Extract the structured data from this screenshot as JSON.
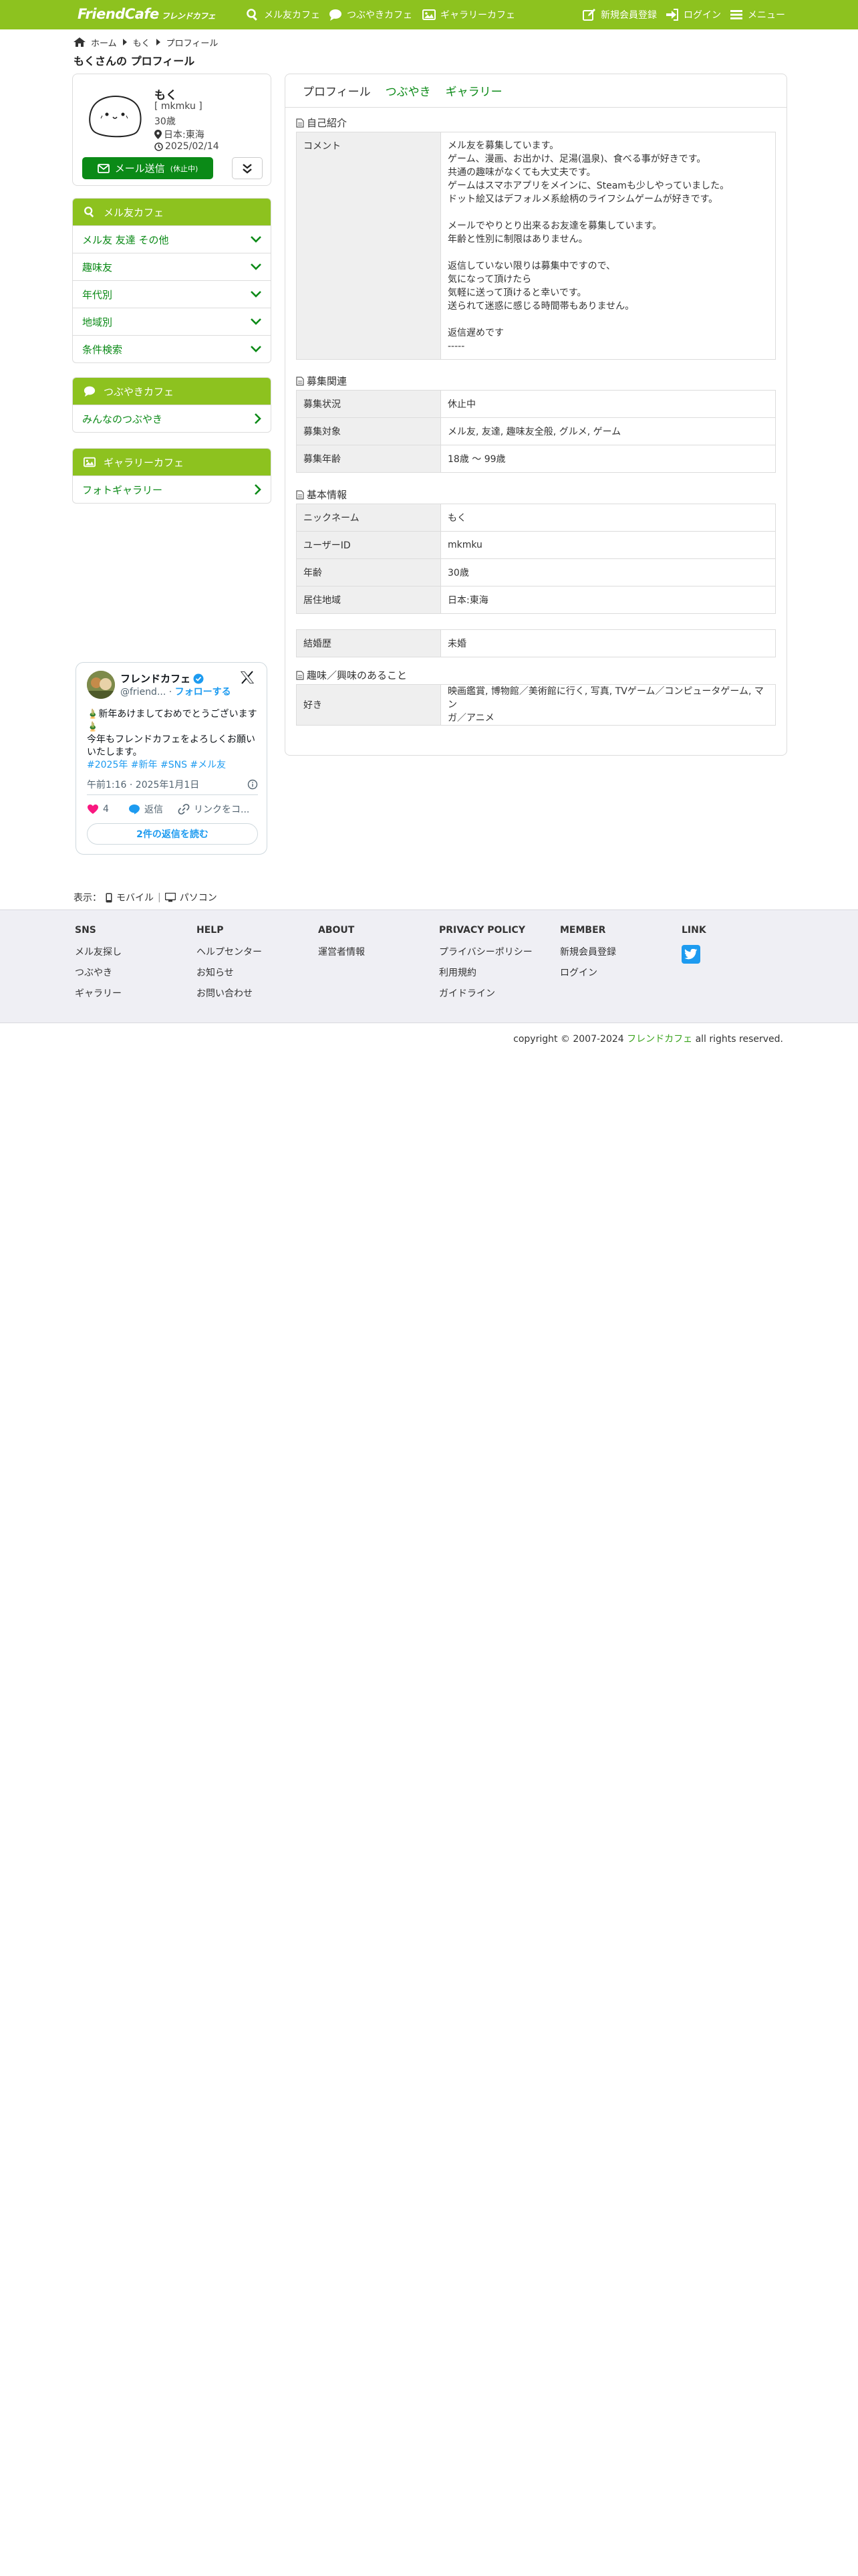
{
  "header": {
    "logo": "FriendCafe",
    "logo_sub": "フレンドカフェ",
    "nav": {
      "mail_cafe": "メル友カフェ",
      "tsubuyaki_cafe": "つぶやきカフェ",
      "gallery_cafe": "ギャラリーカフェ",
      "register": "新規会員登録",
      "login": "ログイン",
      "menu": "メニュー"
    },
    "color": "#8dc21f"
  },
  "breadcrumb": [
    "ホーム",
    "もく",
    "プロフィール"
  ],
  "page_title": "もくさんの プロフィール",
  "profile": {
    "name": "もく",
    "user_id_display": "[ mkmku ]",
    "age": "30歳",
    "location": "日本:東海",
    "date": "2025/02/14",
    "mail_button": "メール送信",
    "mail_button_note": "(休止中)"
  },
  "sidebar": {
    "mail_cafe": {
      "title": "メル友カフェ",
      "items": [
        "メル友 友達 その他",
        "趣味友",
        "年代別",
        "地域別",
        "条件検索"
      ]
    },
    "tsubuyaki_cafe": {
      "title": "つぶやきカフェ",
      "items": [
        "みんなのつぶやき"
      ]
    },
    "gallery_cafe": {
      "title": "ギャラリーカフェ",
      "items": [
        "フォトギャラリー"
      ]
    }
  },
  "tweet": {
    "name": "フレンドカフェ",
    "handle": "@friend...",
    "separator": "·",
    "follow": "フォローする",
    "line1": "🎍新年あけましておめでとうございます🎍",
    "line2": "今年もフレンドカフェをよろしくお願いいたします。",
    "tags": "#2025年 #新年 #SNS #メル友",
    "time": "午前1:16 · 2025年1月1日",
    "likes": "4",
    "reply": "返信",
    "copy_link": "リンクをコ...",
    "read_replies": "2件の返信を読む"
  },
  "tabs": [
    "プロフィール",
    "つぶやき",
    "ギャラリー"
  ],
  "sections": {
    "intro_title": "自己紹介",
    "intro_label": "コメント",
    "intro_lines": [
      "メル友を募集しています。",
      "ゲーム、漫画、お出かけ、足湯(温泉)、食べる事が好きです。",
      "共通の趣味がなくても大丈夫です。",
      "ゲームはスマホアプリをメインに、Steamも少しやっていました。",
      "ドット絵又はデフォルメ系絵柄のライフシムゲームが好きです。",
      "",
      "メールでやりとり出来るお友達を募集しています。",
      "年齢と性別に制限はありません。",
      "",
      "返信していない限りは募集中ですので、",
      "気になって頂けたら",
      "気軽に送って頂けると幸いです。",
      "送られて迷惑に感じる時間帯もありません。",
      "",
      "返信遅めです",
      "-----"
    ],
    "recruit_title": "募集関連",
    "recruit": [
      {
        "k": "募集状況",
        "v": "休止中"
      },
      {
        "k": "募集対象",
        "v": "メル友, 友達, 趣味友全般, グルメ, ゲーム"
      },
      {
        "k": "募集年齢",
        "v": "18歳 〜 99歳"
      }
    ],
    "basic_title": "基本情報",
    "basic": [
      {
        "k": "ニックネーム",
        "v": "もく"
      },
      {
        "k": "ユーザーID",
        "v": "mkmku"
      },
      {
        "k": "年齢",
        "v": "30歳"
      },
      {
        "k": "居住地域",
        "v": "日本:東海"
      }
    ],
    "marriage": {
      "k": "結婚歴",
      "v": "未婚"
    },
    "hobby_title": "趣味／興味のあること",
    "hobby": {
      "k": "好き",
      "v1": "映画鑑賞, 博物館／美術館に行く, 写真, TVゲーム／コンピュータゲーム, マン",
      "v2": "ガ／アニメ"
    }
  },
  "display": {
    "label": "表示：",
    "mobile": "モバイル",
    "sep": "|",
    "pc": "パソコン"
  },
  "footer": {
    "columns": [
      {
        "head": "SNS",
        "links": [
          "メル友探し",
          "つぶやき",
          "ギャラリー"
        ]
      },
      {
        "head": "HELP",
        "links": [
          "ヘルプセンター",
          "お知らせ",
          "お問い合わせ"
        ]
      },
      {
        "head": "ABOUT",
        "links": [
          "運営者情報"
        ]
      },
      {
        "head": "PRIVACY POLICY",
        "links": [
          "プライバシーポリシー",
          "利用規約",
          "ガイドライン"
        ]
      },
      {
        "head": "MEMBER",
        "links": [
          "新規会員登録",
          "ログイン"
        ]
      },
      {
        "head": "LINK",
        "links": []
      }
    ],
    "copyright_pre": "copyright © 2007-2024 ",
    "copyright_brand": "フレンドカフェ",
    "copyright_post": " all rights reserved."
  }
}
